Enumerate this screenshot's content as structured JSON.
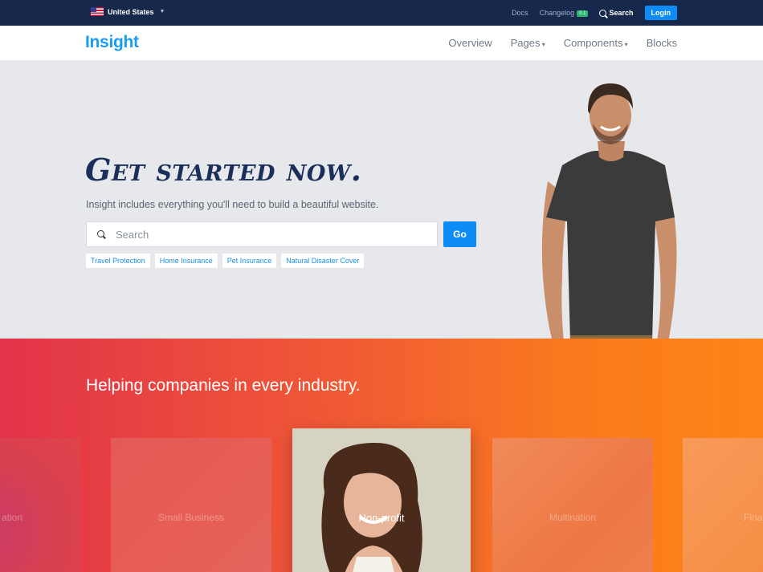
{
  "topbar": {
    "region": "United States",
    "links": {
      "docs": "Docs",
      "changelog": "Changelog",
      "changelog_badge": "0.1",
      "search": "Search",
      "login": "Login"
    }
  },
  "navbar": {
    "logo": "Insight",
    "items": [
      "Overview",
      "Pages",
      "Components",
      "Blocks"
    ]
  },
  "hero": {
    "title": "Get started now.",
    "subtitle": "Insight includes everything you'll need to build a beautiful website.",
    "search_placeholder": "Search",
    "go_label": "Go",
    "tags": [
      "Travel Protection",
      "Home Insurance",
      "Pet Insurance",
      "Natural Disaster Cover"
    ]
  },
  "industries": {
    "title": "Helping companies in every industry.",
    "cards": [
      "ation",
      "Small Business",
      "Non-profit",
      "Multination",
      "Fina"
    ]
  },
  "colors": {
    "topbar": "#17284d",
    "accent": "#0d8cf5",
    "band_start": "#e2334a",
    "band_end": "#fd8417"
  }
}
